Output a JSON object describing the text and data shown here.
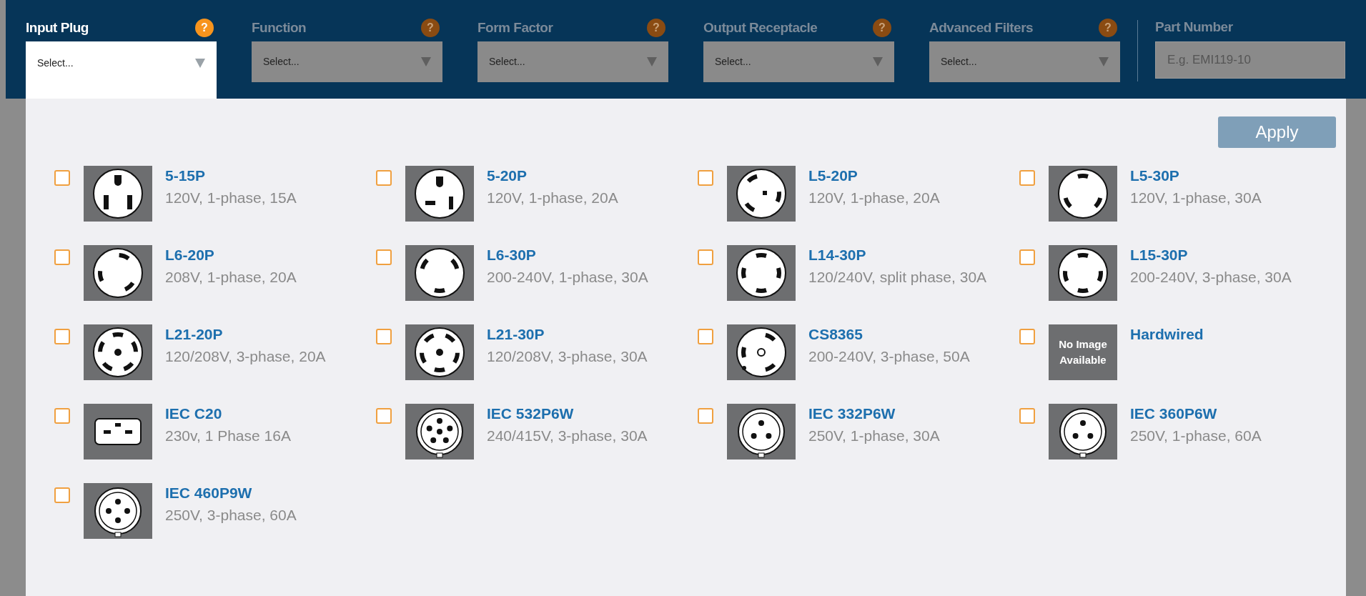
{
  "filters": [
    {
      "label": "Input Plug",
      "help": "?",
      "placeholder": "Select...",
      "expanded": true
    },
    {
      "label": "Function",
      "help": "?",
      "placeholder": "Select...",
      "expanded": false
    },
    {
      "label": "Form Factor",
      "help": "?",
      "placeholder": "Select...",
      "expanded": false
    },
    {
      "label": "Output Receptacle",
      "help": "?",
      "placeholder": "Select...",
      "expanded": false
    },
    {
      "label": "Advanced Filters",
      "help": "?",
      "placeholder": "Select...",
      "expanded": false
    }
  ],
  "part_number": {
    "label": "Part Number",
    "placeholder": "E.g. EMI119-10"
  },
  "apply_button": "Apply",
  "plugs": [
    {
      "name": "5-15P",
      "spec": "120V, 1-phase, 15A",
      "checked": false
    },
    {
      "name": "5-20P",
      "spec": "120V, 1-phase, 20A",
      "checked": false
    },
    {
      "name": "L5-20P",
      "spec": "120V, 1-phase, 20A",
      "checked": false
    },
    {
      "name": "L5-30P",
      "spec": "120V, 1-phase, 30A",
      "checked": false
    },
    {
      "name": "L6-20P",
      "spec": "208V, 1-phase, 20A",
      "checked": false
    },
    {
      "name": "L6-30P",
      "spec": "200-240V, 1-phase, 30A",
      "checked": false
    },
    {
      "name": "L14-30P",
      "spec": "120/240V, split phase, 30A",
      "checked": false
    },
    {
      "name": "L15-30P",
      "spec": "200-240V, 3-phase, 30A",
      "checked": false
    },
    {
      "name": "L21-20P",
      "spec": "120/208V, 3-phase, 20A",
      "checked": false
    },
    {
      "name": "L21-30P",
      "spec": "120/208V, 3-phase, 30A",
      "checked": false
    },
    {
      "name": "CS8365",
      "spec": "200-240V, 3-phase, 50A",
      "checked": false
    },
    {
      "name": "Hardwired",
      "image_text": "No Image Available",
      "checked": false
    },
    {
      "name": "IEC C20",
      "spec": "230v, 1 Phase 16A",
      "checked": false
    },
    {
      "name": "IEC 532P6W",
      "spec": "240/415V, 3-phase, 30A",
      "checked": false
    },
    {
      "name": "IEC 332P6W",
      "spec": "250V, 1-phase, 30A",
      "checked": false
    },
    {
      "name": "IEC 360P6W",
      "spec": "250V, 1-phase, 60A",
      "checked": false
    },
    {
      "name": "IEC 460P9W",
      "spec": "250V, 3-phase, 60A",
      "checked": false
    }
  ]
}
